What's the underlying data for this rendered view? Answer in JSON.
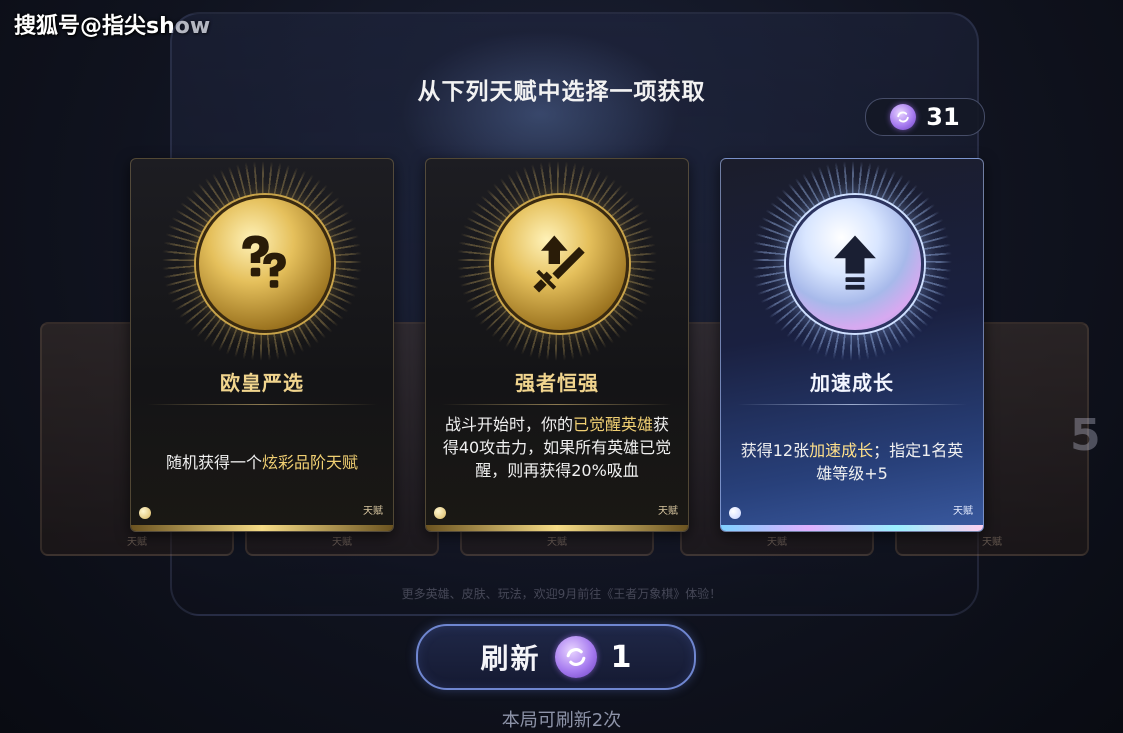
{
  "watermark": "搜狐号@指尖show",
  "title": "从下列天赋中选择一项获取",
  "currency": {
    "icon": "swirl-coin-icon",
    "amount": "31"
  },
  "background": {
    "big_number": "5",
    "tag_label": "天赋",
    "faint_caption": "更多英雄、皮肤、玩法，欢迎9月前往《王者万象棋》体验！"
  },
  "cards": [
    {
      "name": "欧皇严选",
      "icon": "question-marks-icon",
      "style": "gold",
      "desc_parts": [
        {
          "text": "随机获得一个",
          "hl": false
        },
        {
          "text": "炫彩品阶天赋",
          "hl": true
        }
      ],
      "tag": "天赋"
    },
    {
      "name": "强者恒强",
      "icon": "sword-arrow-icon",
      "style": "gold",
      "desc_parts": [
        {
          "text": "战斗开始时，你的",
          "hl": false
        },
        {
          "text": "已觉醒英雄",
          "hl": true
        },
        {
          "text": "获得40攻击力，如果所有英雄已觉醒，则再获得20%吸血",
          "hl": false
        }
      ],
      "tag": "天赋"
    },
    {
      "name": "加速成长",
      "icon": "up-arrow-icon",
      "style": "prism",
      "desc_parts": [
        {
          "text": "获得12张",
          "hl": false
        },
        {
          "text": "加速成长",
          "hl": true
        },
        {
          "text": "；指定1名英雄等级+5",
          "hl": false
        }
      ],
      "tag": "天赋"
    }
  ],
  "refresh": {
    "label": "刷新",
    "icon": "swirl-coin-icon",
    "cost": "1",
    "note": "本局可刷新2次"
  },
  "colors": {
    "gold": "#f1d58e",
    "highlight": "#f0cf72",
    "button_border": "#6f86d0",
    "coin": "#a77cf0"
  }
}
